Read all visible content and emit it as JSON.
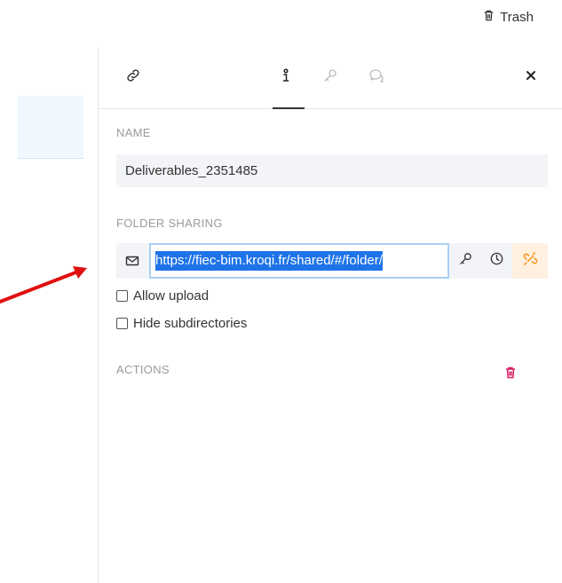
{
  "header": {
    "trash_label": "Trash"
  },
  "panel": {
    "tabs": [
      {
        "id": "share-link",
        "icon": "link-icon"
      },
      {
        "id": "info",
        "icon": "info-icon",
        "active": true
      },
      {
        "id": "permissions",
        "icon": "key-icon"
      },
      {
        "id": "comments",
        "icon": "chat-icon"
      }
    ],
    "close_icon": "close-icon",
    "name_section": {
      "label": "NAME",
      "value": "Deliverables_2351485"
    },
    "sharing_section": {
      "label": "FOLDER SHARING",
      "url": "https://fiec-bim.kroqi.fr/shared/#/folder/",
      "allow_upload_label": "Allow upload",
      "allow_upload_checked": false,
      "hide_subdirectories_label": "Hide subdirectories",
      "hide_subdirectories_checked": false
    },
    "actions_section": {
      "label": "ACTIONS"
    }
  },
  "colors": {
    "accent_blue": "#1e73e8",
    "delete_red": "#d81b60",
    "unlink_orange": "#f59a23",
    "annotation_arrow": "#e01010"
  }
}
